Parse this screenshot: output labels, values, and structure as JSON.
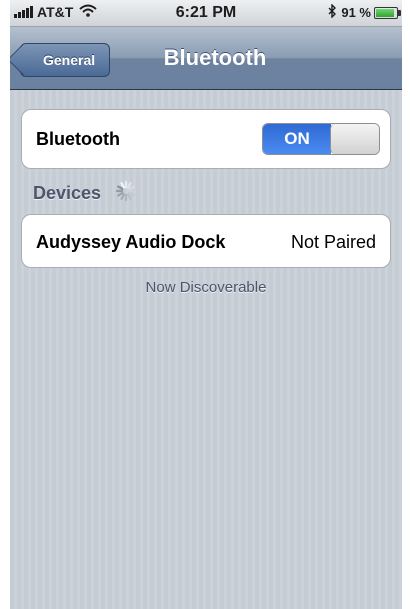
{
  "status_bar": {
    "carrier": "AT&T",
    "time": "6:21 PM",
    "battery_percent": "91 %",
    "icons": [
      "signal-icon",
      "wifi-icon",
      "bluetooth-icon",
      "battery-icon"
    ]
  },
  "nav": {
    "back_label": "General",
    "title": "Bluetooth"
  },
  "bluetooth_cell": {
    "label": "Bluetooth",
    "toggle_label": "ON",
    "toggle_state": true
  },
  "devices_section": {
    "header": "Devices",
    "items": [
      {
        "name": "Audyssey Audio Dock",
        "status": "Not Paired"
      }
    ]
  },
  "footer": "Now Discoverable",
  "colors": {
    "toggle_on": "#2e6ad4",
    "nav_bar": "#6d83a0",
    "background": "#c5ccd4"
  }
}
